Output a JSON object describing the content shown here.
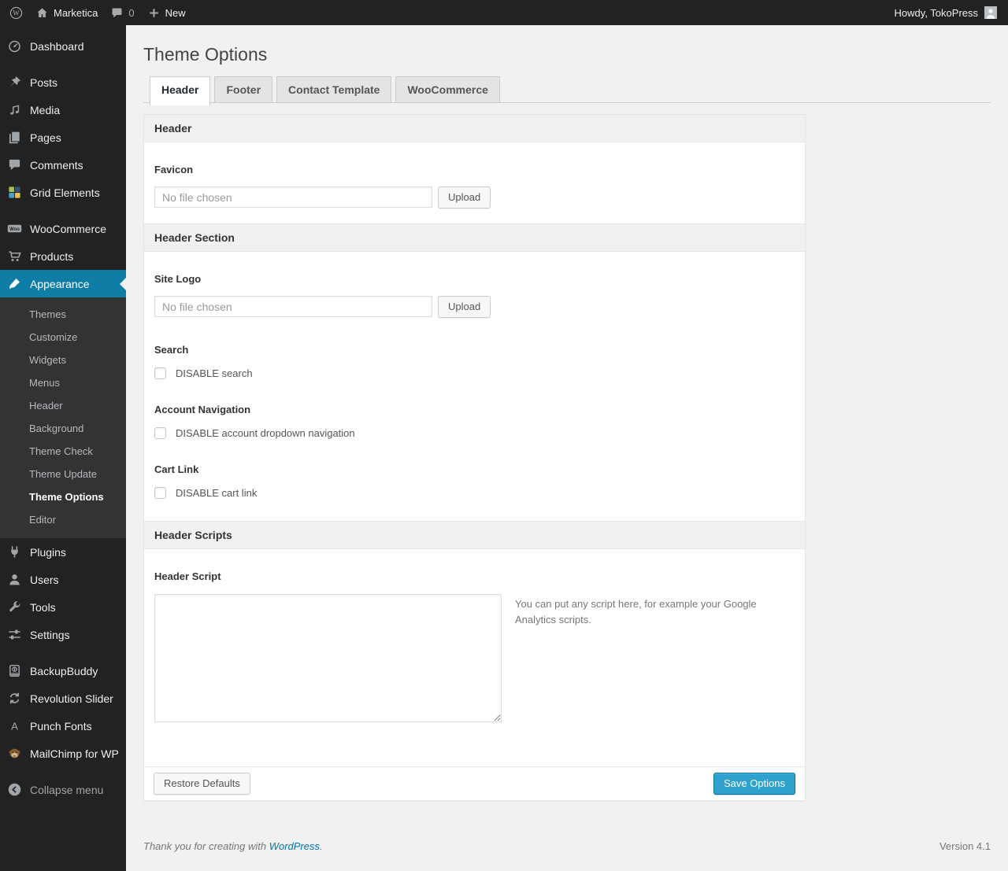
{
  "admin_bar": {
    "site_name": "Marketica",
    "comment_count": "0",
    "new_label": "New",
    "howdy": "Howdy, TokoPress"
  },
  "sidebar": {
    "items": [
      {
        "label": "Dashboard",
        "icon": "dashboard-icon"
      },
      {
        "label": "Posts",
        "icon": "pushpin-icon",
        "gap": true
      },
      {
        "label": "Media",
        "icon": "media-icon"
      },
      {
        "label": "Pages",
        "icon": "pages-icon"
      },
      {
        "label": "Comments",
        "icon": "comment-bubble-icon"
      },
      {
        "label": "Grid Elements",
        "icon": "grid-elements-icon"
      },
      {
        "label": "WooCommerce",
        "icon": "woocommerce-icon",
        "gap": true
      },
      {
        "label": "Products",
        "icon": "cart-icon"
      },
      {
        "label": "Appearance",
        "icon": "paintbrush-icon",
        "active": true,
        "submenu": [
          "Themes",
          "Customize",
          "Widgets",
          "Menus",
          "Header",
          "Background",
          "Theme Check",
          "Theme Update",
          "Theme Options",
          "Editor"
        ],
        "current_submenu": "Theme Options"
      },
      {
        "label": "Plugins",
        "icon": "plug-icon"
      },
      {
        "label": "Users",
        "icon": "user-icon"
      },
      {
        "label": "Tools",
        "icon": "wrench-icon"
      },
      {
        "label": "Settings",
        "icon": "sliders-icon"
      },
      {
        "label": "BackupBuddy",
        "icon": "backup-icon",
        "gap": true
      },
      {
        "label": "Revolution Slider",
        "icon": "refresh-icon"
      },
      {
        "label": "Punch Fonts",
        "icon": "letter-a-icon"
      },
      {
        "label": "MailChimp for WP",
        "icon": "monkey-icon"
      },
      {
        "label": "Collapse menu",
        "icon": "collapse-arrow-icon",
        "gap": true,
        "muted": true
      }
    ]
  },
  "content": {
    "title": "Theme Options",
    "tabs": [
      {
        "label": "Header",
        "active": true
      },
      {
        "label": "Footer"
      },
      {
        "label": "Contact Template"
      },
      {
        "label": "WooCommerce"
      }
    ],
    "sections": {
      "header": {
        "title": "Header"
      },
      "favicon": {
        "label": "Favicon",
        "placeholder": "No file chosen",
        "upload": "Upload"
      },
      "header_section": {
        "title": "Header Section"
      },
      "site_logo": {
        "label": "Site Logo",
        "placeholder": "No file chosen",
        "upload": "Upload"
      },
      "search": {
        "label": "Search",
        "checkbox": "DISABLE search",
        "checked": false
      },
      "account_nav": {
        "label": "Account Navigation",
        "checkbox": "DISABLE account dropdown navigation",
        "checked": false
      },
      "cart_link": {
        "label": "Cart Link",
        "checkbox": "DISABLE cart link",
        "checked": false
      },
      "header_scripts": {
        "title": "Header Scripts"
      },
      "header_script": {
        "label": "Header Script",
        "value": "",
        "help": "You can put any script here, for example your Google Analytics scripts."
      }
    },
    "actions": {
      "restore": "Restore Defaults",
      "save": "Save Options"
    }
  },
  "footer": {
    "thanks_prefix": "Thank you for creating with ",
    "wordpress_link": "WordPress",
    "thanks_suffix": ".",
    "version": "Version 4.1"
  },
  "colors": {
    "admin_bar_bg": "#222222",
    "menu_active_bg": "#0e7ea6",
    "primary_button_bg": "#2ea2cc",
    "primary_button_border": "#0074a2",
    "link": "#0074a2",
    "page_bg": "#f1f1f1"
  }
}
